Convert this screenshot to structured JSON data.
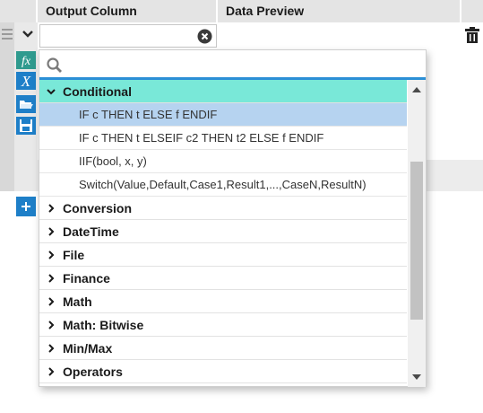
{
  "grid": {
    "columns": [
      {
        "label": ""
      },
      {
        "label": "Output Column"
      },
      {
        "label": "Data Preview"
      },
      {
        "label": ""
      }
    ],
    "expression_value": ""
  },
  "toolbar_icons": [
    "function-icon",
    "variable-icon",
    "open-file-icon",
    "save-icon"
  ],
  "search": {
    "placeholder": "",
    "value": ""
  },
  "categories": [
    {
      "label": "Conditional",
      "expanded": true,
      "functions": [
        {
          "label": "IF c THEN t ELSE f ENDIF",
          "selected": true
        },
        {
          "label": "IF c THEN t ELSEIF c2 THEN t2 ELSE f ENDIF",
          "selected": false
        },
        {
          "label": "IIF(bool, x, y)",
          "selected": false
        },
        {
          "label": "Switch(Value,Default,Case1,Result1,...,CaseN,ResultN)",
          "selected": false
        }
      ]
    },
    {
      "label": "Conversion",
      "expanded": false
    },
    {
      "label": "DateTime",
      "expanded": false
    },
    {
      "label": "File",
      "expanded": false
    },
    {
      "label": "Finance",
      "expanded": false
    },
    {
      "label": "Math",
      "expanded": false
    },
    {
      "label": "Math: Bitwise",
      "expanded": false
    },
    {
      "label": "Min/Max",
      "expanded": false
    },
    {
      "label": "Operators",
      "expanded": false
    }
  ],
  "colors": {
    "open_category": "#79e8d8",
    "selected_function": "#b6d3f0",
    "accent": "#2b8fd6",
    "tool_icon_bg": "#1e7fc8"
  }
}
